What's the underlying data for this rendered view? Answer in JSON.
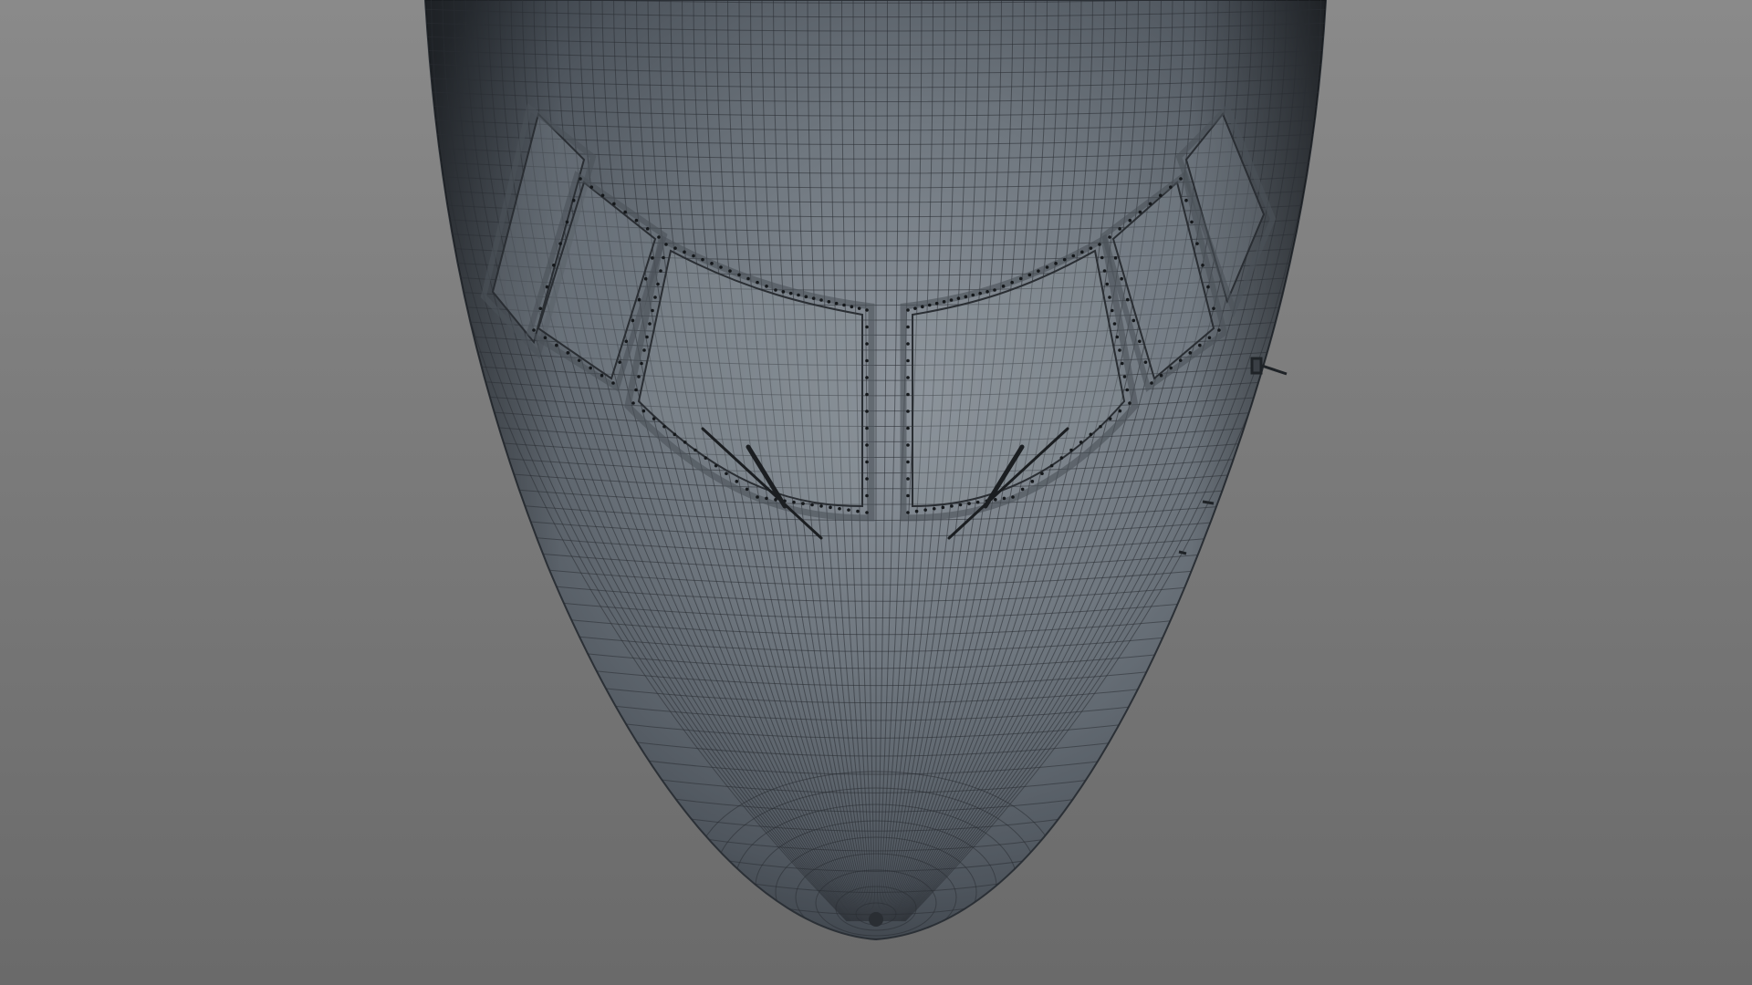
{
  "viewport": {
    "background_top": "#8a8a8a",
    "background_bottom": "#6a6a6a"
  },
  "model": {
    "subject": "aircraft-nose-wireframe",
    "surface_color_light": "#8d949c",
    "surface_color_mid": "#5f6770",
    "surface_color_dark": "#353b42",
    "wire_color": "#2a2e33",
    "frame_color": "#4b5158",
    "rivet_color": "#15181b"
  }
}
